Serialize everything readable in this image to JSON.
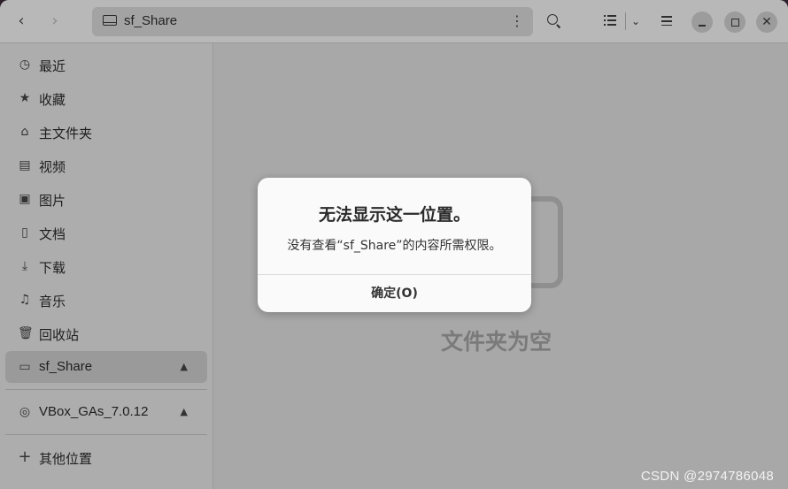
{
  "header": {
    "path_label": "sf_Share",
    "back_icon": "chevron-left-icon",
    "forward_icon": "chevron-right-icon",
    "path_menu_glyph": "⋮",
    "close_glyph": "✕"
  },
  "sidebar": {
    "items": [
      {
        "label": "最近",
        "icon": "clock-icon",
        "glyph": "◷"
      },
      {
        "label": "收藏",
        "icon": "star-icon",
        "glyph": "★"
      },
      {
        "label": "主文件夹",
        "icon": "home-icon",
        "glyph": "⌂"
      },
      {
        "label": "视频",
        "icon": "film-icon",
        "glyph": "▤"
      },
      {
        "label": "图片",
        "icon": "image-icon",
        "glyph": "▣"
      },
      {
        "label": "文档",
        "icon": "document-icon",
        "glyph": "▯"
      },
      {
        "label": "下载",
        "icon": "download-icon",
        "glyph": "⤓"
      },
      {
        "label": "音乐",
        "icon": "music-icon",
        "glyph": "♫"
      },
      {
        "label": "回收站",
        "icon": "trash-icon",
        "glyph": "🗑"
      }
    ],
    "mounts": [
      {
        "label": "sf_Share",
        "icon": "drive-icon",
        "glyph": "▭",
        "eject": "▲",
        "active": true
      },
      {
        "label": "VBox_GAs_7.0.12",
        "icon": "disc-icon",
        "glyph": "◎",
        "eject": "▲"
      }
    ],
    "other": {
      "label": "其他位置",
      "icon": "plus-icon",
      "glyph": "+"
    }
  },
  "content": {
    "empty_text": "文件夹为空"
  },
  "dialog": {
    "title": "无法显示这一位置。",
    "message": "没有查看“sf_Share”的内容所需权限。",
    "ok_label": "确定(O)"
  },
  "watermark": "CSDN @2974786048"
}
